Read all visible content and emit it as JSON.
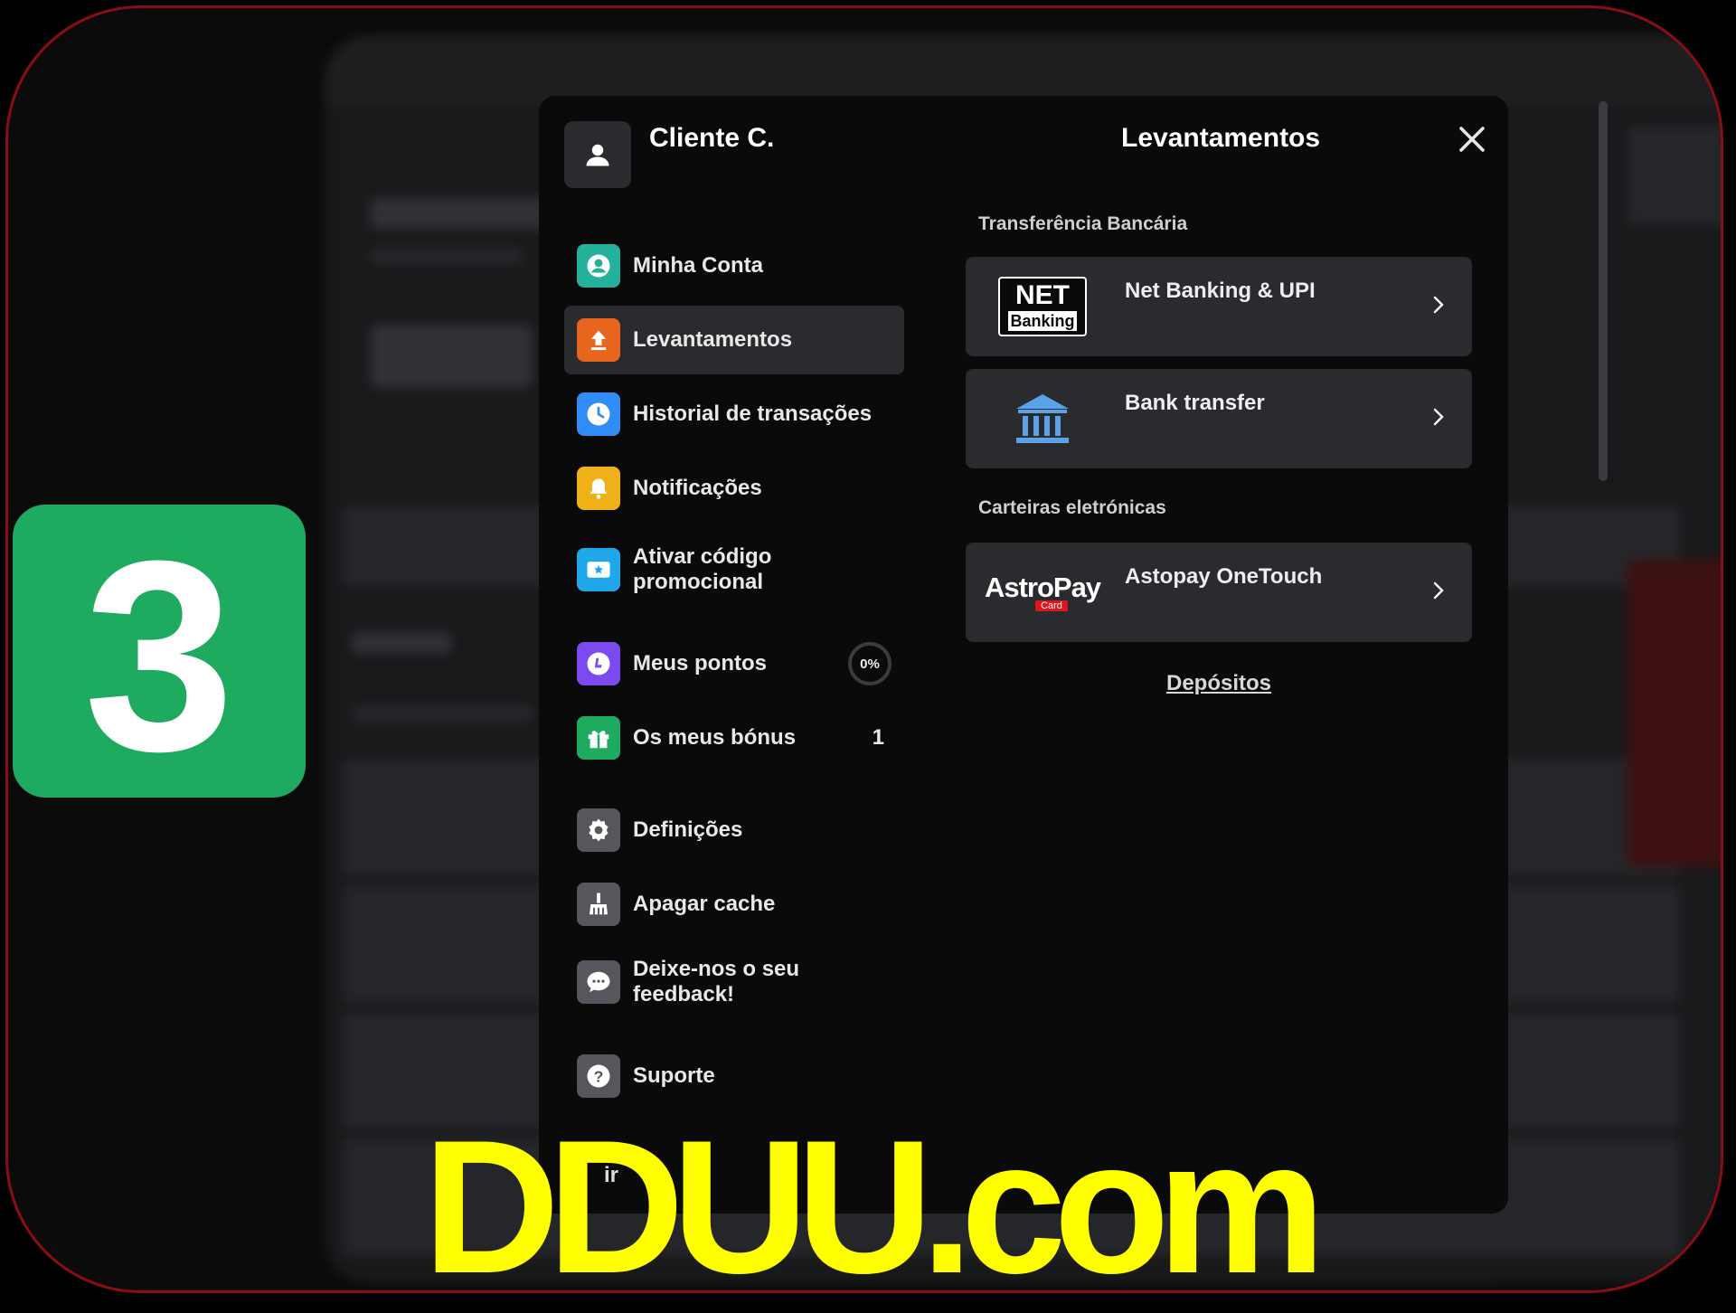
{
  "badge": {
    "step": "3"
  },
  "user": {
    "name": "Cliente C."
  },
  "menu": {
    "items": [
      {
        "label": "Minha Conta",
        "icon": "account-icon",
        "color": "#25b09b"
      },
      {
        "label": "Levantamentos",
        "icon": "withdraw-icon",
        "color": "#e8651e",
        "active": true
      },
      {
        "label": "Historial de transações",
        "icon": "clock-icon",
        "color": "#2f8df5"
      },
      {
        "label": "Notificações",
        "icon": "bell-icon",
        "color": "#efb019"
      },
      {
        "label": "Ativar código promocional",
        "icon": "ticket-icon",
        "color": "#1ea8ea"
      },
      {
        "label": "Meus pontos",
        "icon": "loyalty-icon",
        "color": "#7b4bf0",
        "progress": "0%"
      },
      {
        "label": "Os meus bónus",
        "icon": "gift-icon",
        "color": "#1eaa5f",
        "count": "1"
      },
      {
        "label": "Definições",
        "icon": "gear-icon",
        "color": "#55575c"
      },
      {
        "label": "Apagar cache",
        "icon": "broom-icon",
        "color": "#55575c"
      },
      {
        "label": "Deixe-nos o seu feedback!",
        "icon": "chat-icon",
        "color": "#55575c"
      },
      {
        "label": "Suporte",
        "icon": "help-icon",
        "color": "#55575c"
      }
    ],
    "logout_fragment": "ir"
  },
  "panel": {
    "title": "Levantamentos",
    "sections": [
      {
        "title": "Transferência Bancária",
        "options": [
          {
            "name": "Net Banking & UPI",
            "logo": "netbanking-logo",
            "logo_text_1": "NET",
            "logo_text_2": "Banking"
          },
          {
            "name": "Bank transfer",
            "logo": "bank-icon"
          }
        ]
      },
      {
        "title": "Carteiras eletrónicas",
        "options": [
          {
            "name": "Astopay OneTouch",
            "logo": "astropay-logo",
            "logo_text_1": "AstroPay",
            "logo_text_2": "Card"
          }
        ]
      }
    ],
    "deposits_link": "Depósitos"
  },
  "watermark": "DDUU.com",
  "colors": {
    "frame": "#8a0d14",
    "badge": "#1eaa5f",
    "watermark": "#ffff00"
  }
}
